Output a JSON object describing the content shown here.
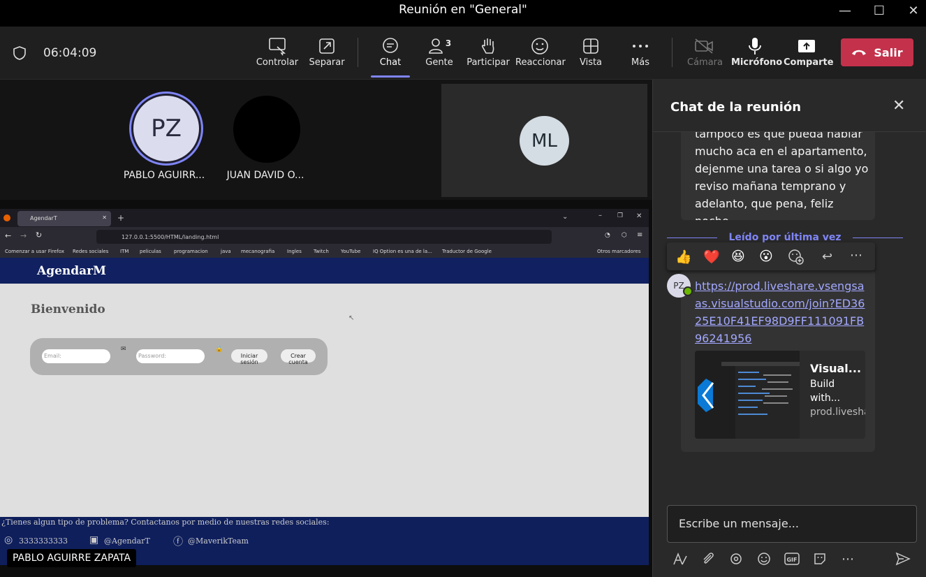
{
  "window": {
    "title": "Reunión en \"General\"",
    "minimize": "—",
    "maximize": "☐",
    "close": "✕"
  },
  "toolbar": {
    "timer": "06:04:09",
    "items": [
      {
        "label": "Controlar"
      },
      {
        "label": "Separar"
      },
      {
        "label": "Chat"
      },
      {
        "label": "Gente",
        "count": "3"
      },
      {
        "label": "Participar"
      },
      {
        "label": "Reaccionar"
      },
      {
        "label": "Vista"
      },
      {
        "label": "Más"
      },
      {
        "label": "Cámara"
      },
      {
        "label": "Micrófono"
      },
      {
        "label": "Comparte"
      }
    ],
    "leave_label": "Salir"
  },
  "participants": [
    {
      "initials": "PZ",
      "name": "PABLO AGUIRR..."
    },
    {
      "initials": "",
      "name": "JUAN DAVID O..."
    },
    {
      "initials": "ML",
      "name": ""
    }
  ],
  "shared_screen": {
    "browser": {
      "tab_title": "AgendarT",
      "url": "127.0.0.1:5500/HTML/landing.html",
      "bookmarks": [
        "Comenzar a usar Firefox",
        "Redes sociales",
        "ITM",
        "peliculas",
        "programacion",
        "java",
        "mecanografia",
        "Ingles",
        "Twitch",
        "YouTube",
        "IQ Option es una de la...",
        "Traductor de Google",
        "Otros marcadores"
      ]
    },
    "site": {
      "logo": "AgendarM",
      "welcome": "Bienvenido",
      "email_placeholder": "Email:",
      "password_placeholder": "Password:",
      "login_button": "Iniciar sesión",
      "register_button": "Crear cuenta",
      "footer_text": "¿Tienes algun tipo de problema? Contactanos por medio de nuestras redes sociales:",
      "phone": "3333333333",
      "instagram": "@AgendarT",
      "facebook": "@MaverikTeam"
    },
    "presenter_tag": "PABLO AGUIRRE ZAPATA"
  },
  "chat": {
    "title": "Chat de la reunión",
    "previous_message": "tampoco es que pueda hablar mucho aca en el apartamento, dejenme una tarea o si algo yo reviso mañana temprano y adelanto, que pena, feliz noche",
    "last_read": "Leído por última vez",
    "reactions": [
      "👍",
      "❤️",
      "😆",
      "😮"
    ],
    "sender_initials": "PZ",
    "link": "https://prod.liveshare.vsengsaas.visualstudio.com/join?ED3625E10F41EF98D9FF111091FB96241956",
    "card": {
      "title": "Visual...",
      "description": "Build with...",
      "url": "prod.liveshare.vs..."
    },
    "compose_placeholder": "Escribe un mensaje..."
  },
  "colors": {
    "accent": "#7f85f5",
    "leave": "#c4314b",
    "site_header": "#102060"
  }
}
